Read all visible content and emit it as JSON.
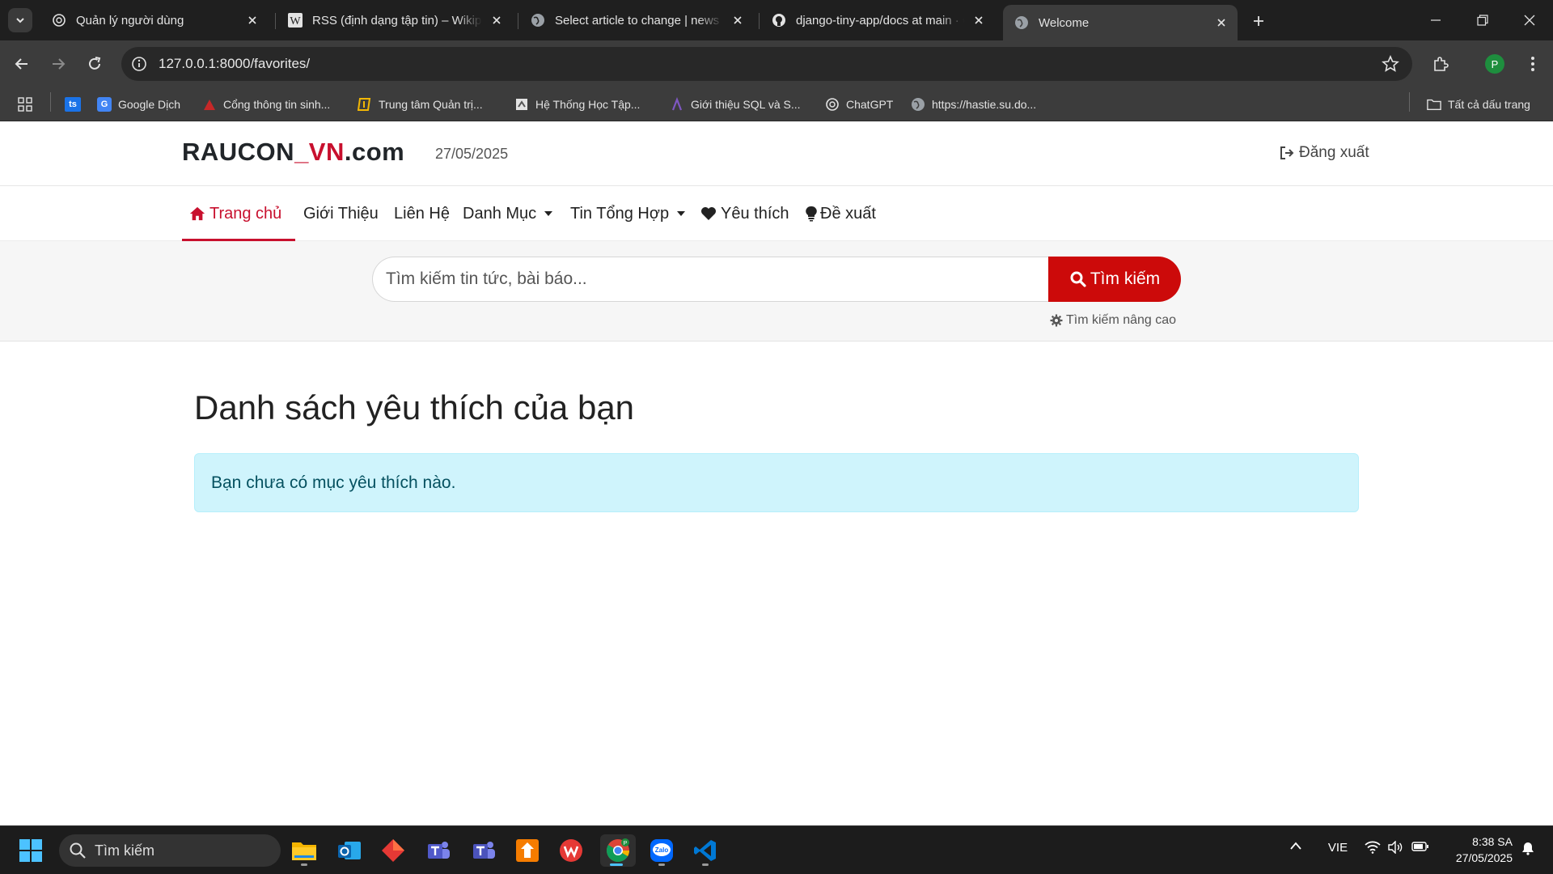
{
  "browser": {
    "tabs": [
      {
        "title": "Quản lý người dùng",
        "icon": "openai-icon",
        "active": false
      },
      {
        "title": "RSS (định dạng tập tin) – Wikipedia",
        "icon": "wikipedia-icon",
        "active": false
      },
      {
        "title": "Select article to change | news admin",
        "icon": "globe-icon",
        "active": false
      },
      {
        "title": "django-tiny-app/docs at main · GitHub",
        "icon": "github-icon",
        "active": false
      },
      {
        "title": "Welcome",
        "icon": "globe-icon",
        "active": true
      }
    ],
    "url": "127.0.0.1:8000/favorites/",
    "profile_initial": "P",
    "bookmarks": [
      {
        "label": "Google Dịch",
        "icon": "google-translate-icon"
      },
      {
        "label": "Cổng thông tin sinh...",
        "icon": "student-portal-icon"
      },
      {
        "label": "Trung tâm Quản trị...",
        "icon": "admin-center-icon"
      },
      {
        "label": "Hệ Thống Học Tập...",
        "icon": "learning-system-icon"
      },
      {
        "label": "Giới thiệu SQL và S...",
        "icon": "sql-icon"
      },
      {
        "label": "ChatGPT",
        "icon": "openai-icon"
      },
      {
        "label": "https://hastie.su.do...",
        "icon": "globe-icon"
      }
    ],
    "bookmarks_first_icon_text": "ts",
    "all_bookmarks_label": "Tất cả dấu trang"
  },
  "site": {
    "logo": {
      "part1": "RAUCON",
      "part2": "_VN",
      "part3": ".com"
    },
    "date": "27/05/2025",
    "logout_label": "Đăng xuất",
    "nav": [
      {
        "label": "Trang chủ",
        "icon": "home-icon",
        "active": true
      },
      {
        "label": "Giới Thiệu"
      },
      {
        "label": "Liên Hệ"
      },
      {
        "label": "Danh Mục",
        "dropdown": true
      },
      {
        "label": "Tin Tổng Hợp",
        "dropdown": true
      },
      {
        "label": "Yêu thích",
        "icon": "heart-icon"
      },
      {
        "label": "Đề xuất",
        "icon": "lightbulb-icon"
      }
    ],
    "search": {
      "placeholder": "Tìm kiếm tin tức, bài báo...",
      "button_label": "Tìm kiếm",
      "advanced_label": "Tìm kiếm nâng cao"
    }
  },
  "main": {
    "title": "Danh sách yêu thích của bạn",
    "empty_message": "Bạn chưa có mục yêu thích nào."
  },
  "taskbar": {
    "search_label": "Tìm kiếm",
    "language": "VIE",
    "time": "8:38 SA",
    "date": "27/05/2025",
    "apps": [
      "file-explorer-icon",
      "outlook-icon",
      "app-diamond-icon",
      "teams-icon",
      "teams-classic-icon",
      "office-app-icon",
      "wps-icon",
      "chrome-icon",
      "zalo-icon",
      "vscode-icon"
    ],
    "zalo_label": "Zalo"
  },
  "colors": {
    "brand_red": "#c8102e",
    "search_red": "#cc0a0a",
    "alert_bg": "#cff4fc",
    "alert_text": "#055160"
  }
}
